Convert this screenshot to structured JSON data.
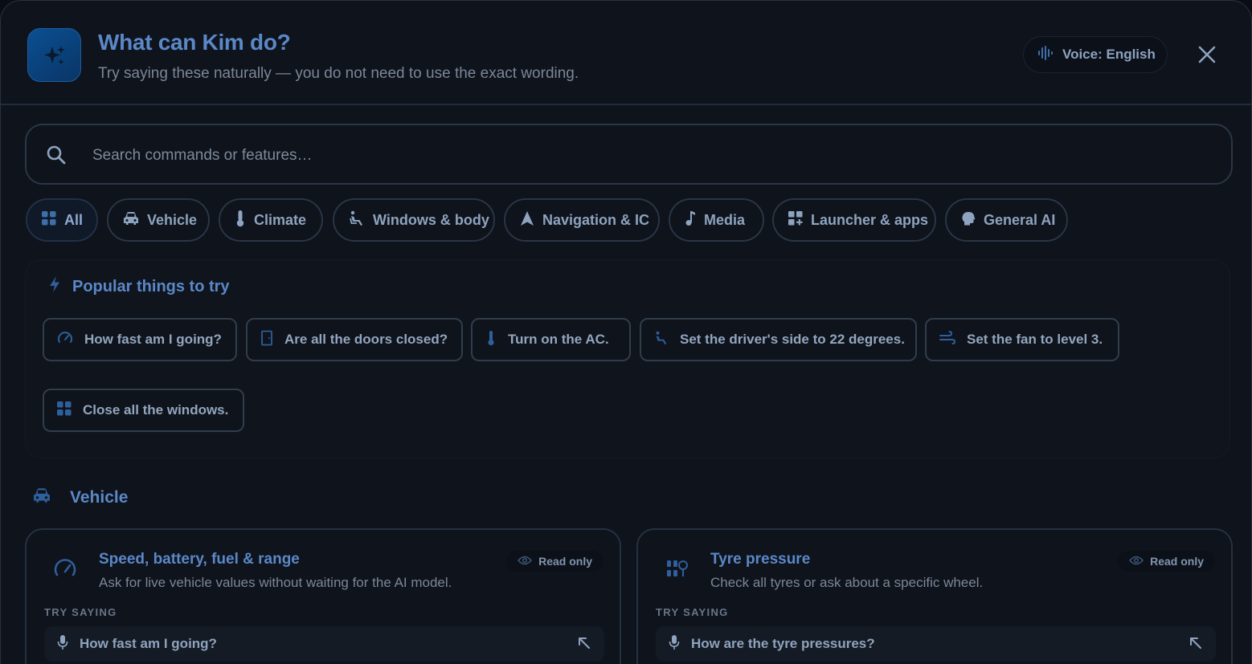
{
  "header": {
    "title": "What can Kim do?",
    "subtitle": "Try saying these naturally — you do not need to use the exact wording.",
    "voice_label": "Voice: English"
  },
  "search": {
    "placeholder": "Search commands or features…",
    "value": ""
  },
  "categories": [
    {
      "label": "All",
      "icon": "grid-icon",
      "active": true
    },
    {
      "label": "Vehicle",
      "icon": "car-icon"
    },
    {
      "label": "Climate",
      "icon": "thermometer-icon"
    },
    {
      "label": "Windows & body",
      "icon": "seat-icon"
    },
    {
      "label": "Navigation & IC",
      "icon": "navigation-arrow-icon"
    },
    {
      "label": "Media",
      "icon": "music-note-icon"
    },
    {
      "label": "Launcher & apps",
      "icon": "apps-icon"
    },
    {
      "label": "General AI",
      "icon": "brain-icon"
    }
  ],
  "popular": {
    "title": "Popular things to try",
    "items": [
      {
        "label": "How fast am I going?",
        "icon": "speedometer-icon"
      },
      {
        "label": "Are all the doors closed?",
        "icon": "door-icon"
      },
      {
        "label": "Turn on the AC.",
        "icon": "thermometer-icon"
      },
      {
        "label": "Set the driver's side to 22 degrees.",
        "icon": "seat-icon"
      },
      {
        "label": "Set the fan to level 3.",
        "icon": "fan-icon"
      },
      {
        "label": "Close all the windows.",
        "icon": "window-icon"
      }
    ]
  },
  "vehicle_section": {
    "title": "Vehicle",
    "cards": [
      {
        "title": "Speed, battery, fuel & range",
        "description": "Ask for live vehicle values without waiting for the AI model.",
        "badge": "Read only",
        "try_label": "TRY SAYING",
        "example": "How fast am I going?"
      },
      {
        "title": "Tyre pressure",
        "description": "Check all tyres or ask about a specific wheel.",
        "badge": "Read only",
        "try_label": "TRY SAYING",
        "example": "How are the tyre pressures?"
      }
    ]
  },
  "colors": {
    "accent": "#5b88c7",
    "background": "#0e131c",
    "border": "#2a3545"
  }
}
